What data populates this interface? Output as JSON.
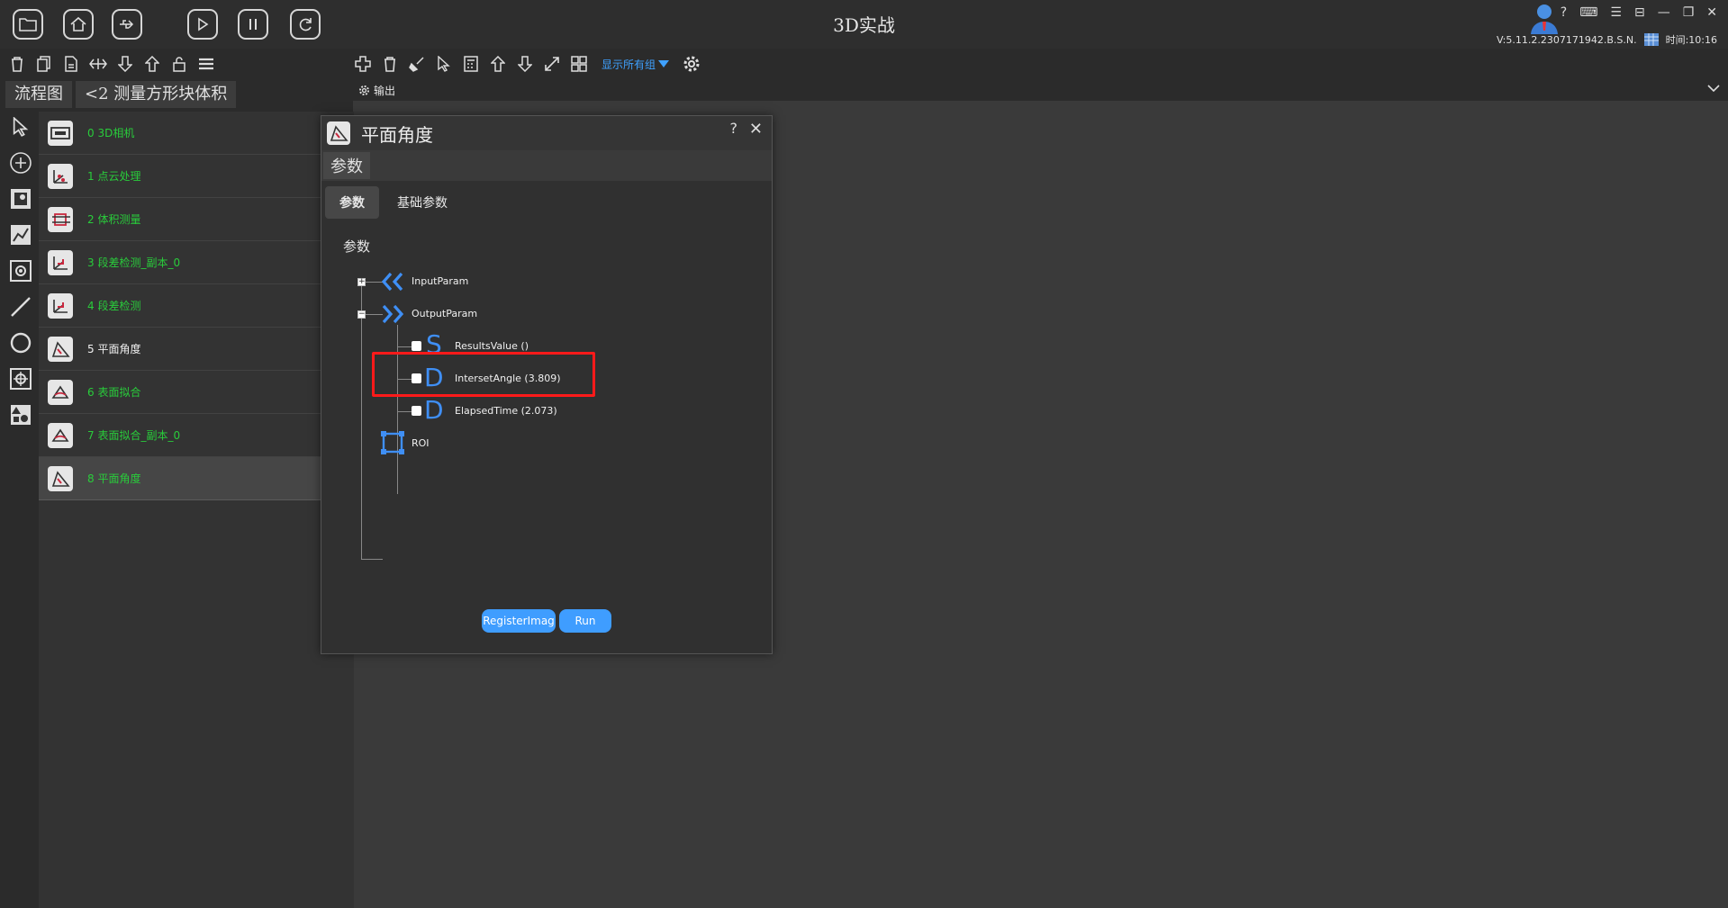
{
  "window": {
    "title": "3D实战",
    "version": "V:5.11.2.2307171942.B.S.N.",
    "time": "时间:10:16",
    "help": "?",
    "minimize": "—",
    "restore": "❐",
    "close": "✕"
  },
  "toolbar": {
    "group_select": "显示所有组"
  },
  "breadcrumb": {
    "root": "流程图",
    "current": "<2 测量方形块体积"
  },
  "output": {
    "label": "输出"
  },
  "flow": {
    "nodes": [
      {
        "label": "0 3D相机",
        "white": false
      },
      {
        "label": "1 点云处理",
        "white": false
      },
      {
        "label": "2 体积测量",
        "white": false
      },
      {
        "label": "3 段差检测_副本_0",
        "white": false
      },
      {
        "label": "4 段差检测",
        "white": false
      },
      {
        "label": "5 平面角度",
        "white": true
      },
      {
        "label": "6 表面拟合",
        "white": false
      },
      {
        "label": "7 表面拟合_副本_0",
        "white": false
      },
      {
        "label": "8 平面角度",
        "white": false
      }
    ]
  },
  "dialog": {
    "title": "平面角度",
    "help": "?",
    "close": "✕",
    "section": "参数",
    "tabs": [
      "参数",
      "基础参数"
    ],
    "group_label": "参数",
    "tree": {
      "input": "InputParam",
      "output": "OutputParam",
      "results": "ResultsValue  ()",
      "angle": "IntersetAngle  (3.809)",
      "elapsed": "ElapsedTime  (2.073)",
      "roi": "ROI"
    },
    "glyphs": {
      "string": "S",
      "double": "D"
    },
    "buttons": {
      "register": "RegisterImag",
      "run": "Run"
    }
  },
  "colors": {
    "accent": "#3f9dff",
    "node_text": "#29cc3b",
    "highlight": "#ff1a1a"
  }
}
